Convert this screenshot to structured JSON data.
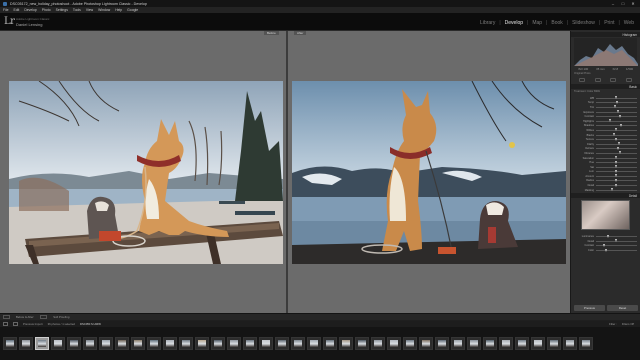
{
  "window": {
    "title": "DSC05172_new_holiday_photoshoot - Adobe Photoshop Lightroom Classic - Develop",
    "controls": [
      "minimize",
      "maximize",
      "close"
    ]
  },
  "menu": [
    "File",
    "Edit",
    "Develop",
    "Photo",
    "Settings",
    "Tools",
    "View",
    "Window",
    "Help",
    "Google"
  ],
  "identity": {
    "logo": "Lr",
    "subtitle": "Adobe Lightroom Classic",
    "name": "Daniel Lensing"
  },
  "modules": {
    "items": [
      "Library",
      "Develop",
      "Map",
      "Book",
      "Slideshow",
      "Print",
      "Web"
    ],
    "active": "Develop"
  },
  "viewer": {
    "before_label": "Before",
    "after_label": "After"
  },
  "right_panel": {
    "histogram_title": "Histogram",
    "readouts": [
      "ISO 100",
      "35 mm",
      "f/2.8",
      "1/500"
    ],
    "original_photo": "Original Photo",
    "basic_title": "Basic",
    "tone_header": "Treatment: Color  B&W",
    "sliders": [
      {
        "label": "WB",
        "value": 0.5
      },
      {
        "label": "Temp",
        "value": 0.52
      },
      {
        "label": "Tint",
        "value": 0.48
      },
      {
        "label": "Exposure",
        "value": 0.55
      },
      {
        "label": "Contrast",
        "value": 0.6
      },
      {
        "label": "Highlights",
        "value": 0.35
      },
      {
        "label": "Shadows",
        "value": 0.62
      },
      {
        "label": "Whites",
        "value": 0.5
      },
      {
        "label": "Blacks",
        "value": 0.45
      },
      {
        "label": "Texture",
        "value": 0.5
      },
      {
        "label": "Clarity",
        "value": 0.58
      },
      {
        "label": "Dehaze",
        "value": 0.55
      },
      {
        "label": "Vibrance",
        "value": 0.6
      },
      {
        "label": "Saturation",
        "value": 0.5
      },
      {
        "label": "Hue",
        "value": 0.5
      },
      {
        "label": "Sat",
        "value": 0.5
      },
      {
        "label": "Lum",
        "value": 0.5
      },
      {
        "label": "Amount",
        "value": 0.5
      },
      {
        "label": "Radius",
        "value": 0.5
      },
      {
        "label": "Detail",
        "value": 0.5
      },
      {
        "label": "Masking",
        "value": 0.4
      }
    ],
    "detail_title": "Detail",
    "lower_sliders": [
      {
        "label": "Luminance",
        "value": 0.3
      },
      {
        "label": "Detail",
        "value": 0.5
      },
      {
        "label": "Contrast",
        "value": 0.2
      },
      {
        "label": "Color",
        "value": 0.25
      }
    ],
    "buttons": [
      "Previous",
      "Reset"
    ]
  },
  "toolbar": {
    "view_label": "Before & After:",
    "soft_proof": "Soft Proofing"
  },
  "filmstrip": {
    "source": "Previous Import",
    "count": "36 photos / 1 selected",
    "filename": "DSC05172.ARW",
    "filter": "Filter :",
    "filter_value": "Filters Off",
    "thumb_colors": [
      "#5b6a78",
      "#8a8f96",
      "#6e7a86",
      "#b9bdc4",
      "#4d5560",
      "#7c838c",
      "#9aa2ab",
      "#6a5e52",
      "#8b7d6b",
      "#5e6d7a",
      "#a8aeb6",
      "#707a84",
      "#b5a58d",
      "#4f5a66",
      "#8d949c",
      "#6b7682",
      "#c2c6cc",
      "#5a646e",
      "#7f8891",
      "#9ea6ae",
      "#66717c",
      "#a39584",
      "#4c5660",
      "#8f969e",
      "#b0b6bd",
      "#6d7883",
      "#7e6f60",
      "#5c6773",
      "#9ba2aa",
      "#858d96",
      "#53606c",
      "#a6acb3",
      "#6f7a85",
      "#b8bcc2",
      "#5f6a75",
      "#8c939b",
      "#7a838d"
    ],
    "selected_index": 2
  }
}
